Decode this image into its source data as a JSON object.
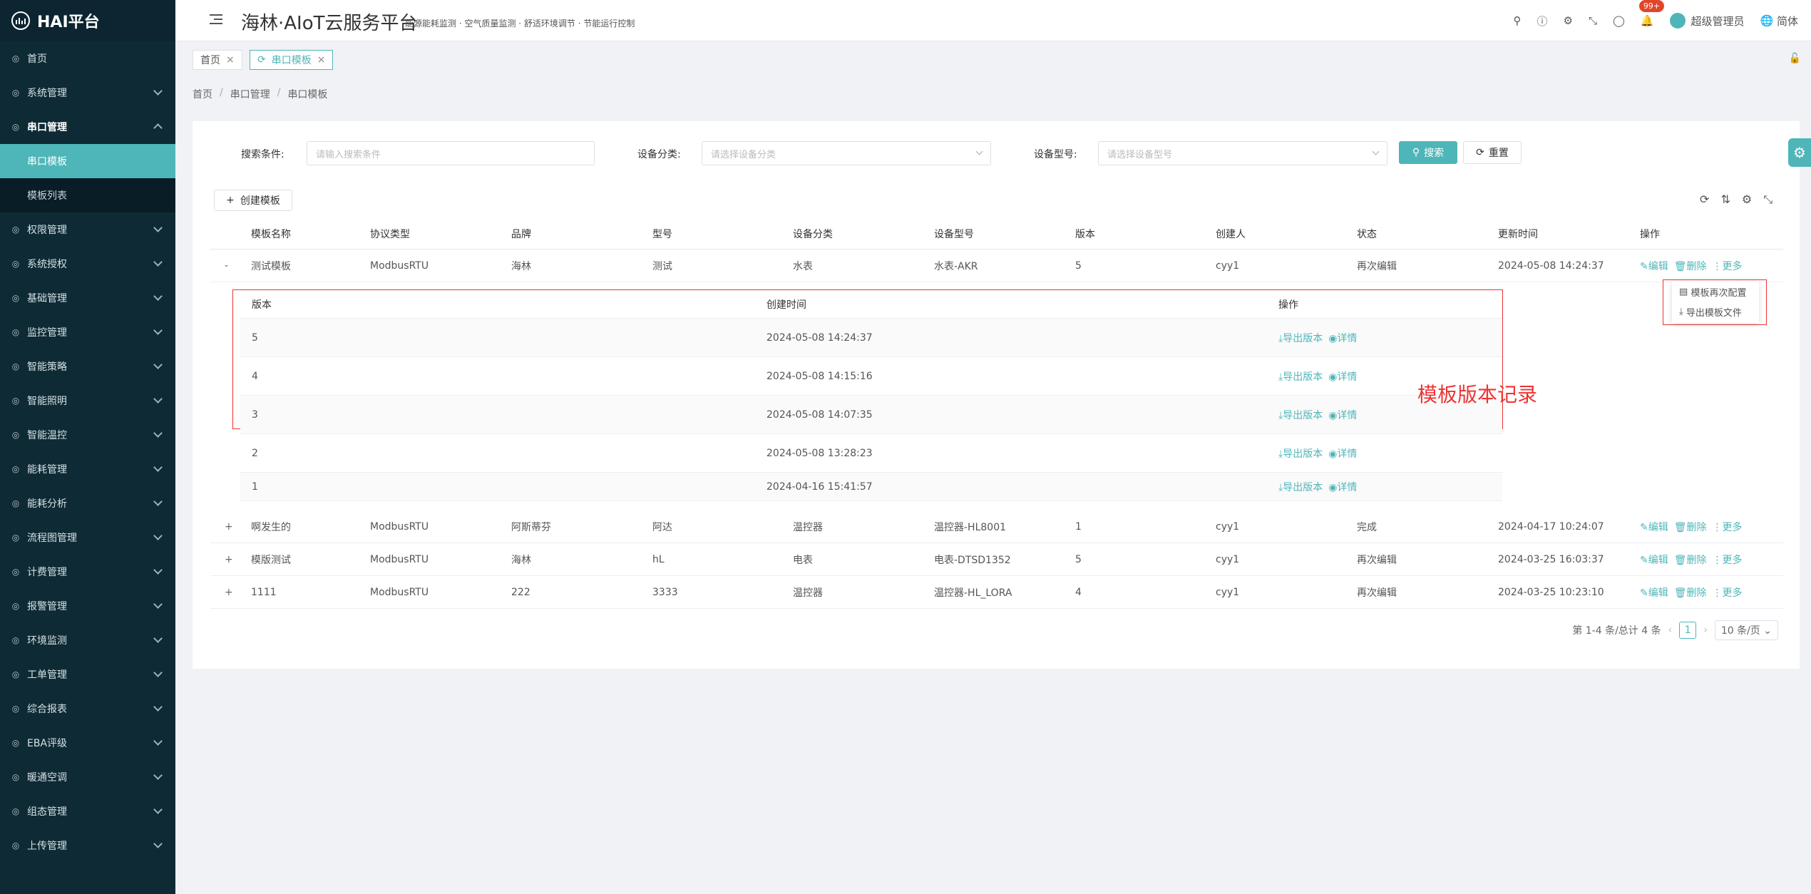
{
  "sidebar": {
    "logo": "HAI平台",
    "menu": [
      {
        "label": "首页",
        "icon": "dashboard-icon"
      },
      {
        "label": "系统管理",
        "icon": "monitor-icon"
      },
      {
        "label": "串口管理",
        "icon": "sliders-icon",
        "open": true
      },
      {
        "label": "权限管理",
        "icon": "shield-icon"
      },
      {
        "label": "系统授权",
        "icon": "key-icon"
      },
      {
        "label": "基础管理",
        "icon": "database-icon"
      },
      {
        "label": "监控管理",
        "icon": "video-icon"
      },
      {
        "label": "智能策略",
        "icon": "strategy-icon"
      },
      {
        "label": "智能照明",
        "icon": "bulb-icon"
      },
      {
        "label": "智能温控",
        "icon": "thermo-icon"
      },
      {
        "label": "能耗管理",
        "icon": "energy-icon"
      },
      {
        "label": "能耗分析",
        "icon": "chart-icon"
      },
      {
        "label": "流程图管理",
        "icon": "flow-icon"
      },
      {
        "label": "计费管理",
        "icon": "bill-icon"
      },
      {
        "label": "报警管理",
        "icon": "alarm-icon"
      },
      {
        "label": "环境监测",
        "icon": "leaf-icon"
      },
      {
        "label": "工单管理",
        "icon": "order-icon"
      },
      {
        "label": "综合报表",
        "icon": "report-icon"
      },
      {
        "label": "EBA评级",
        "icon": "grade-icon"
      },
      {
        "label": "暖通空调",
        "icon": "hvac-icon"
      },
      {
        "label": "组态管理",
        "icon": "config-icon"
      },
      {
        "label": "上传管理",
        "icon": "upload-icon"
      }
    ],
    "submenu": [
      "串口模板",
      "模板列表"
    ]
  },
  "header": {
    "title": "海林·AIoT云服务平台",
    "subtitle": "能源能耗监测 · 空气质量监测 · 舒适环境调节 · 节能运行控制",
    "badge": "99+",
    "user": "超级管理员",
    "lang": "简体"
  },
  "tabs": [
    {
      "label": "首页"
    },
    {
      "label": "串口模板"
    }
  ],
  "breadcrumb": [
    "首页",
    "串口管理",
    "串口模板"
  ],
  "search": {
    "cond_label": "搜索条件:",
    "cond_placeholder": "请输入搜索条件",
    "cat_label": "设备分类:",
    "cat_placeholder": "请选择设备分类",
    "model_label": "设备型号:",
    "model_placeholder": "请选择设备型号",
    "search_btn": "搜索",
    "reset_btn": "重置"
  },
  "create_btn": "创建模板",
  "table": {
    "headers": [
      "模板名称",
      "协议类型",
      "品牌",
      "型号",
      "设备分类",
      "设备型号",
      "版本",
      "创建人",
      "状态",
      "更新时间",
      "操作"
    ],
    "rows": [
      {
        "toggle": "-",
        "cells": [
          "测试模板",
          "ModbusRTU",
          "海林",
          "测试",
          "水表",
          "水表-AKR",
          "5",
          "cyy1",
          "再次编辑",
          "2024-05-08 14:24:37"
        ]
      },
      {
        "toggle": "+",
        "cells": [
          "啊发生的",
          "ModbusRTU",
          "阿斯蒂芬",
          "阿达",
          "温控器",
          "温控器-HL8001",
          "1",
          "cyy1",
          "完成",
          "2024-04-17 10:24:07"
        ]
      },
      {
        "toggle": "+",
        "cells": [
          "模版测试",
          "ModbusRTU",
          "海林",
          "hL",
          "电表",
          "电表-DTSD1352",
          "5",
          "cyy1",
          "再次编辑",
          "2024-03-25 16:03:37"
        ]
      },
      {
        "toggle": "+",
        "cells": [
          "1111",
          "ModbusRTU",
          "222",
          "3333",
          "温控器",
          "温控器-HL_LORA",
          "4",
          "cyy1",
          "再次编辑",
          "2024-03-25 10:23:10"
        ]
      }
    ],
    "ops": {
      "edit": "编辑",
      "delete": "删除",
      "more": "更多"
    }
  },
  "versions": {
    "headers": [
      "版本",
      "创建时间",
      "操作"
    ],
    "rows": [
      {
        "ver": "5",
        "time": "2024-05-08 14:24:37"
      },
      {
        "ver": "4",
        "time": "2024-05-08 14:15:16"
      },
      {
        "ver": "3",
        "time": "2024-05-08 14:07:35"
      },
      {
        "ver": "2",
        "time": "2024-05-08 13:28:23"
      },
      {
        "ver": "1",
        "time": "2024-04-16 15:41:57"
      }
    ],
    "export": "导出版本",
    "detail": "详情"
  },
  "annotation": "模板版本记录",
  "more_menu": [
    "模板再次配置",
    "导出模板文件"
  ],
  "pagination": {
    "summary": "第 1-4 条/总计 4 条",
    "page": "1",
    "size": "10 条/页"
  },
  "colors": {
    "accent": "#4eb6b9",
    "sidebar": "#0e2a35",
    "annotation": "#e33333"
  }
}
